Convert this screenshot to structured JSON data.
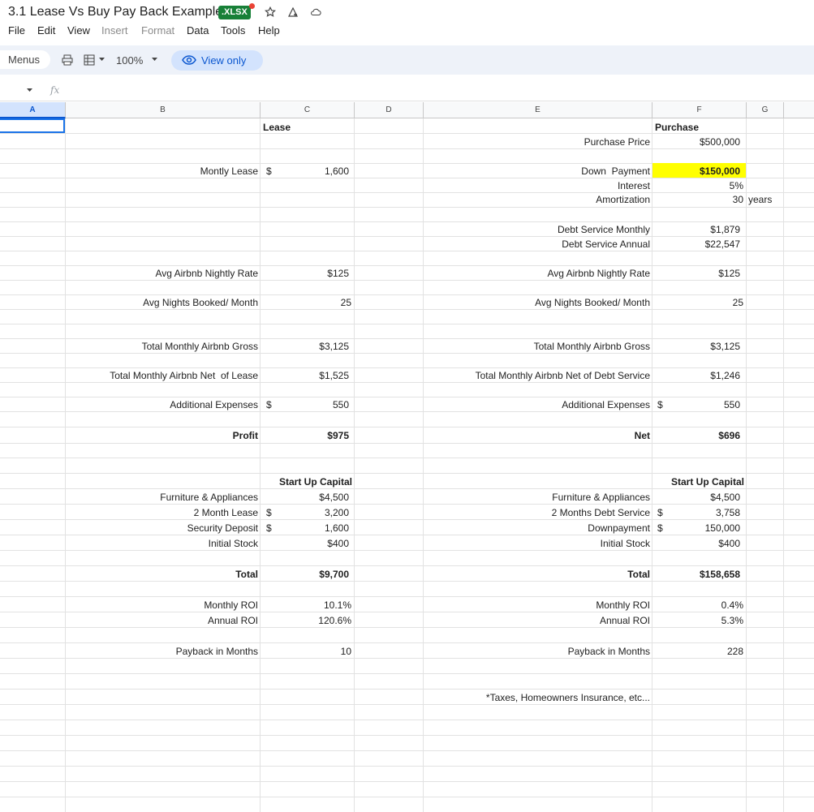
{
  "app": {
    "title": "3.1 Lease Vs Buy Pay Back Example",
    "badge": ".XLSX",
    "menu": [
      "File",
      "Edit",
      "View",
      "Insert",
      "Format",
      "Data",
      "Tools",
      "Help"
    ],
    "toolbar": {
      "menus_label": "Menus",
      "zoom": "100%",
      "view_only": "View only"
    },
    "formula_label": "fx",
    "columns": [
      "A",
      "B",
      "C",
      "D",
      "E",
      "F",
      "G"
    ],
    "selected_cell": "A1"
  },
  "colors": {
    "highlight": "#ffff00",
    "accent": "#0b57d0",
    "badge": "#188038"
  },
  "lease": {
    "header": "Lease",
    "monthly_lease_label": "Montly Lease",
    "monthly_lease_currency": "$",
    "monthly_lease": "1,600",
    "nightly_label": "Avg Airbnb Nightly Rate",
    "nightly": "$125",
    "nights_label": "Avg Nights Booked/ Month",
    "nights": "25",
    "gross_label": "Total Monthly Airbnb Gross",
    "gross": "$3,125",
    "net_label": "Total Monthly Airbnb Net  of Lease",
    "net": "$1,525",
    "expenses_label": "Additional Expenses",
    "expenses_currency": "$",
    "expenses": "550",
    "profit_label": "Profit",
    "profit": "$975",
    "startup_header": "Start Up Capital",
    "furniture_label": "Furniture & Appliances",
    "furniture": "$4,500",
    "two_month_label": "2 Month Lease",
    "two_month_currency": "$",
    "two_month": "3,200",
    "deposit_label": "Security Deposit",
    "deposit_currency": "$",
    "deposit": "1,600",
    "stock_label": "Initial Stock",
    "stock": "$400",
    "total_label": "Total",
    "total": "$9,700",
    "monthly_roi_label": "Monthly ROI",
    "monthly_roi": "10.1%",
    "annual_roi_label": "Annual ROI",
    "annual_roi": "120.6%",
    "payback_label": "Payback in Months",
    "payback": "10"
  },
  "purchase": {
    "header": "Purchase",
    "price_label": "Purchase Price",
    "price": "$500,000",
    "down_label": "Down  Payment",
    "down": "$150,000",
    "interest_label": "Interest",
    "interest": "5%",
    "amort_label": "Amortization",
    "amort": "30",
    "amort_unit": "years",
    "debt_monthly_label": "Debt Service Monthly",
    "debt_monthly": "$1,879",
    "debt_annual_label": "Debt Service Annual",
    "debt_annual": "$22,547",
    "nightly_label": "Avg Airbnb Nightly Rate",
    "nightly": "$125",
    "nights_label": "Avg Nights Booked/ Month",
    "nights": "25",
    "gross_label": "Total Monthly Airbnb Gross",
    "gross": "$3,125",
    "net_label": "Total Monthly Airbnb Net of Debt Service",
    "net": "$1,246",
    "expenses_label": "Additional Expenses",
    "expenses_currency": "$",
    "expenses": "550",
    "net_total_label": "Net",
    "net_total": "$696",
    "startup_header": "Start Up Capital",
    "furniture_label": "Furniture & Appliances",
    "furniture": "$4,500",
    "two_month_label": "2 Months Debt Service",
    "two_month_currency": "$",
    "two_month": "3,758",
    "downpayment_label": "Downpayment",
    "downpayment_currency": "$",
    "downpayment": "150,000",
    "stock_label": "Initial Stock",
    "stock": "$400",
    "total_label": "Total",
    "total": "$158,658",
    "monthly_roi_label": "Monthly ROI",
    "monthly_roi": "0.4%",
    "annual_roi_label": "Annual ROI",
    "annual_roi": "5.3%",
    "payback_label": "Payback in Months",
    "payback": "228",
    "footnote": "*Taxes, Homeowners Insurance, etc..."
  }
}
